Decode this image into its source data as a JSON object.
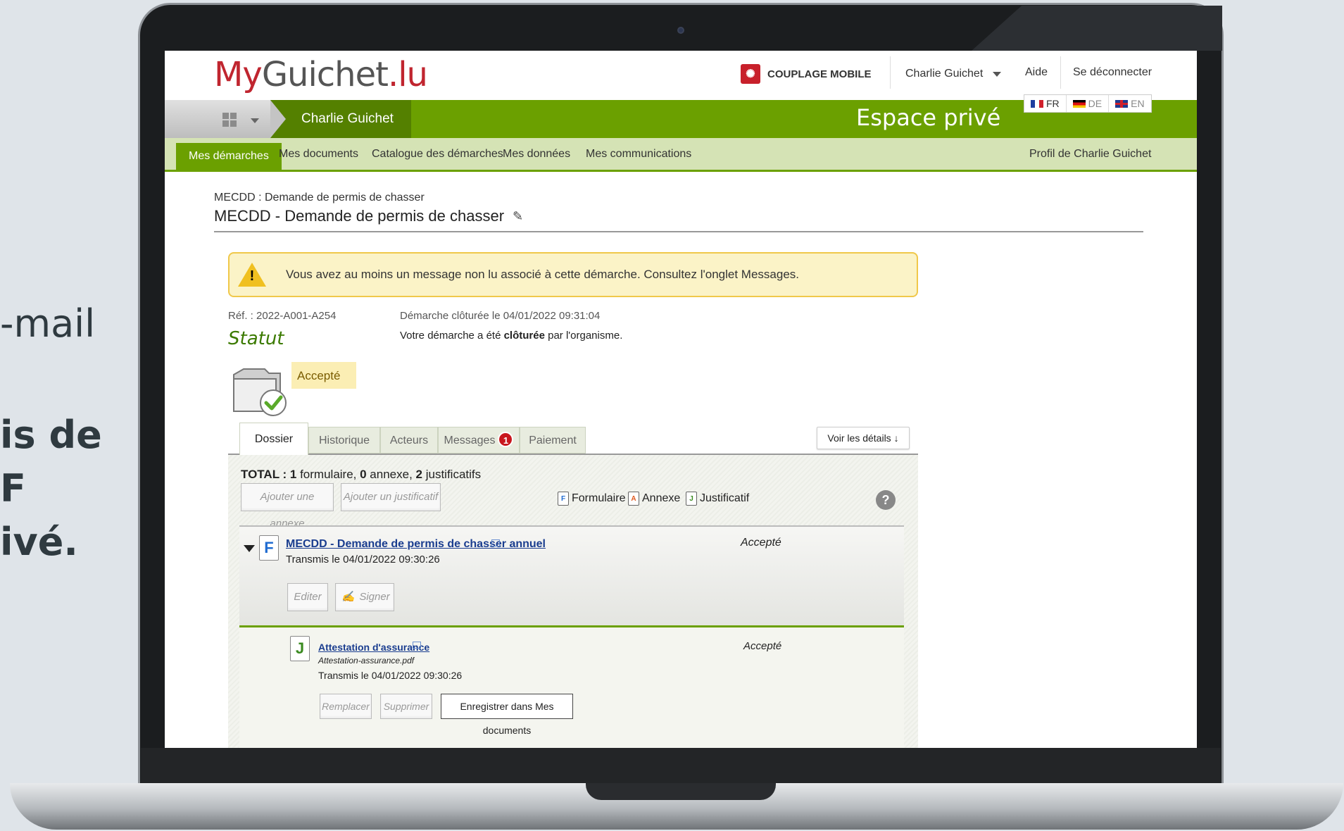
{
  "side_text": {
    "line1": "-mail",
    "line2": "is de",
    "line3": "F",
    "line4": "ivé."
  },
  "header": {
    "logo_my": "My",
    "logo_guichet": "Guichet",
    "logo_lu": ".lu",
    "couplage": "COUPLAGE MOBILE",
    "user_name": "Charlie Guichet",
    "help": "Aide",
    "logout": "Se déconnecter"
  },
  "greenbar": {
    "crumb": "Charlie Guichet",
    "space": "Espace privé",
    "languages": [
      "FR",
      "DE",
      "EN"
    ]
  },
  "nav": {
    "items": [
      "Mes démarches",
      "Mes documents",
      "Catalogue des démarches",
      "Mes données",
      "Mes communications"
    ],
    "profile": "Profil de Charlie Guichet"
  },
  "page": {
    "breadcrumb": "MECDD : Demande de permis de chasser",
    "title": "MECDD - Demande de permis de chasser",
    "alert": "Vous avez au moins un message non lu associé à cette démarche. Consultez l'onglet Messages.",
    "ref": "Réf. : 2022-A001-A254",
    "statut_label": "Statut",
    "closed_date": "Démarche clôturée le 04/01/2022 09:31:04",
    "closed_msg_pre": "Votre démarche a été ",
    "closed_msg_bold": "clôturée",
    "closed_msg_post": " par l'organisme.",
    "status": "Accepté"
  },
  "tabs": {
    "items": [
      "Dossier",
      "Historique",
      "Acteurs",
      "Messages",
      "Paiement"
    ],
    "messages_count": "1",
    "details_button": "Voir les détails ↓"
  },
  "dossier": {
    "total_label": "TOTAL : ",
    "total_form_count": "1",
    "total_form_word": " formulaire, ",
    "total_annex_count": "0",
    "total_annex_word": " annexe, ",
    "total_just_count": "2",
    "total_just_word": " justificatifs",
    "add_annex": "Ajouter une annexe",
    "add_just": "Ajouter un justificatif",
    "legend": [
      "Formulaire",
      "Annexe",
      "Justificatif"
    ],
    "legend_letters": [
      "F",
      "A",
      "J"
    ],
    "help": "?",
    "form": {
      "letter": "F",
      "title": "MECDD - Demande de permis de chasser annuel",
      "transmitted": "Transmis le 04/01/2022 09:30:26",
      "state": "Accepté",
      "edit": "Editer",
      "sign": "Signer"
    },
    "justificatif": {
      "letter": "J",
      "title": "Attestation d'assurance",
      "file": "Attestation-assurance.pdf",
      "transmitted": "Transmis le 04/01/2022 09:30:26",
      "state": "Accepté",
      "replace": "Remplacer",
      "delete": "Supprimer",
      "save": "Enregistrer dans Mes documents"
    }
  }
}
